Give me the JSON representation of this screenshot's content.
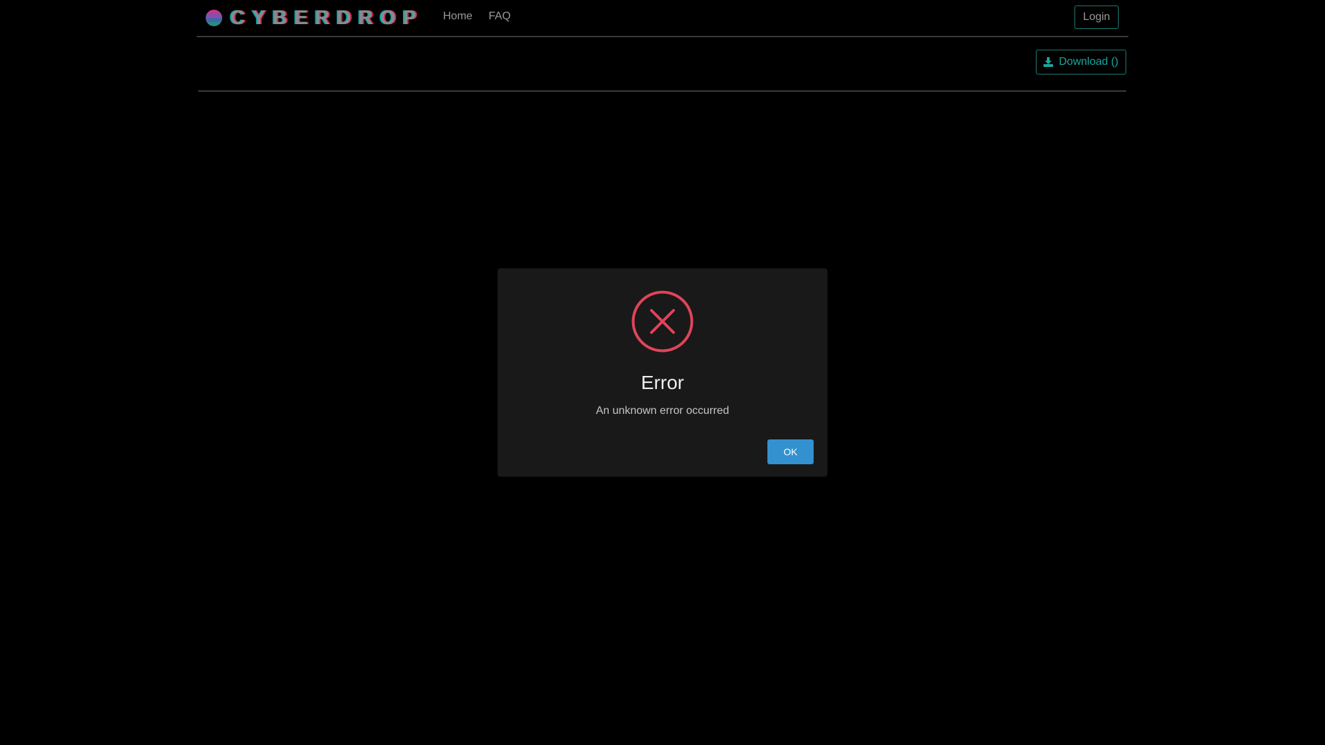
{
  "navbar": {
    "brand": "CYBERDROP",
    "links": [
      {
        "label": "Home"
      },
      {
        "label": "FAQ"
      }
    ],
    "login_label": "Login"
  },
  "toolbar": {
    "download_label": "Download ()",
    "download_icon": "download-icon"
  },
  "modal": {
    "icon": "error-x-icon",
    "title": "Error",
    "message": "An unknown error occurred",
    "ok_label": "OK"
  },
  "colors": {
    "background": "#000000",
    "accent_teal": "#1ba89e",
    "error_red": "#e0445a",
    "ok_blue": "#3391d0",
    "modal_bg": "#191919"
  }
}
